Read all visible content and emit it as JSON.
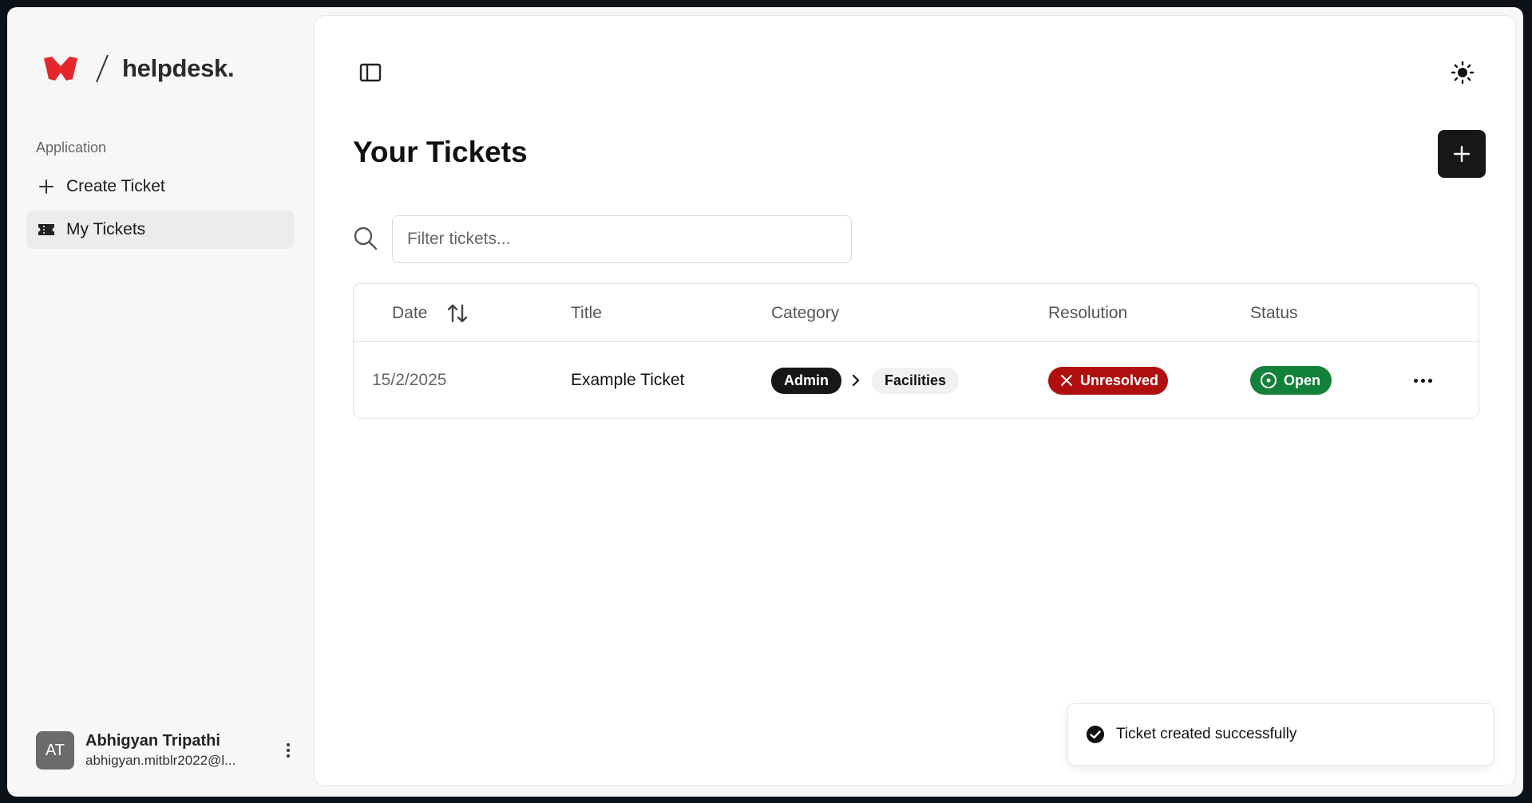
{
  "brand": {
    "name": "helpdesk."
  },
  "sidebar": {
    "section_label": "Application",
    "items": [
      {
        "label": "Create Ticket",
        "icon": "plus-icon"
      },
      {
        "label": "My Tickets",
        "icon": "ticket-icon",
        "active": true
      }
    ]
  },
  "user": {
    "initials": "AT",
    "name": "Abhigyan Tripathi",
    "email": "abhigyan.mitblr2022@l..."
  },
  "main": {
    "title": "Your Tickets",
    "search": {
      "placeholder": "Filter tickets...",
      "value": ""
    },
    "table": {
      "columns": [
        "Date",
        "Title",
        "Category",
        "Resolution",
        "Status"
      ],
      "rows": [
        {
          "date": "15/2/2025",
          "title": "Example Ticket",
          "category": "Admin",
          "subcategory": "Facilities",
          "resolution": "Unresolved",
          "status": "Open"
        }
      ]
    }
  },
  "toast": {
    "message": "Ticket created successfully"
  },
  "colors": {
    "brand_red": "#e5262b",
    "unresolved": "#b00f10",
    "open": "#14813a",
    "primary": "#171717"
  }
}
